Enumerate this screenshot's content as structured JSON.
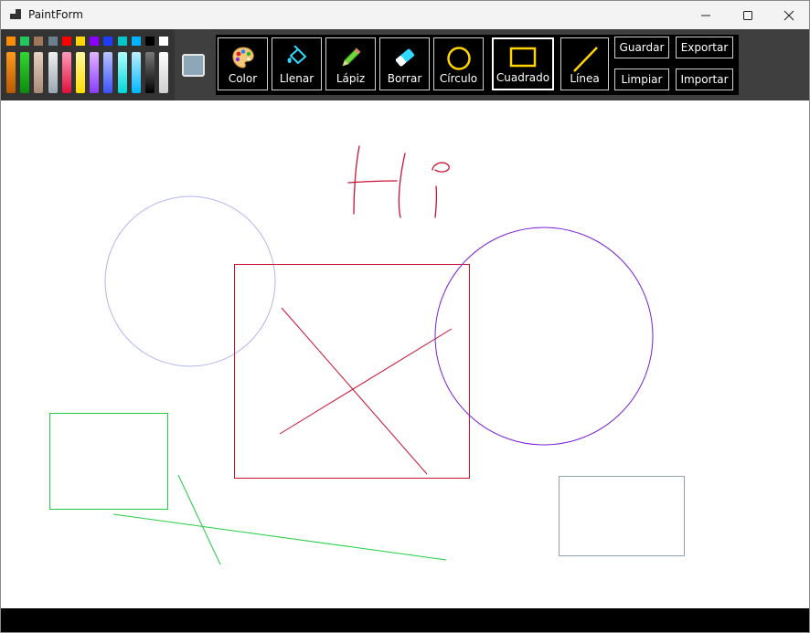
{
  "window": {
    "title": "PaintForm"
  },
  "palette": {
    "top_colors": [
      "#ff8c00",
      "#22c55e",
      "#a0785a",
      "#6b7f8c",
      "#ff0000",
      "#ffd700",
      "#8b00ff",
      "#1e3cff",
      "#00c8c8",
      "#00b4ff",
      "#000000",
      "#ffffff"
    ],
    "column_colors": [
      [
        "#ff9a1a",
        "#b85a00"
      ],
      [
        "#33d633",
        "#0d8c0d"
      ],
      [
        "#e8d2c0",
        "#a88a74"
      ],
      [
        "#f0f0f0",
        "#9aa8b2"
      ],
      [
        "#ff9abb",
        "#e0103c"
      ],
      [
        "#fff8a0",
        "#ffdd00"
      ],
      [
        "#e0b4ff",
        "#8a3cff"
      ],
      [
        "#b8c4ff",
        "#3a52ff"
      ],
      [
        "#b0ffff",
        "#00d8d8"
      ],
      [
        "#bdeeff",
        "#00b8ff"
      ],
      [
        "#7a7a7a",
        "#000000"
      ],
      [
        "#ffffff",
        "#cfcfcf"
      ]
    ],
    "selected_color": "#8ea7b8"
  },
  "tools": {
    "color": "Color",
    "fill": "Llenar",
    "pencil": "Lápiz",
    "eraser": "Borrar",
    "circle": "Círculo",
    "square": "Cuadrado",
    "line": "Línea",
    "active": "Cuadrado"
  },
  "actions": {
    "save": "Guardar",
    "export": "Exportar",
    "clear": "Limpiar",
    "import": "Importar"
  },
  "icons": {
    "color": "palette-icon",
    "fill": "bucket-icon",
    "pencil": "pencil-icon",
    "eraser": "eraser-icon",
    "circle": "circle-icon",
    "square": "square-icon",
    "line": "line-icon",
    "minimize": "minimize-icon",
    "maximize": "maximize-icon",
    "close": "close-icon"
  },
  "drawing": {
    "shapes_colors": {
      "red": "#cc1133",
      "purple": "#7a1fd6",
      "lavender": "#b4b4ee",
      "green": "#22cc44",
      "slate": "#8fa3b3"
    }
  }
}
